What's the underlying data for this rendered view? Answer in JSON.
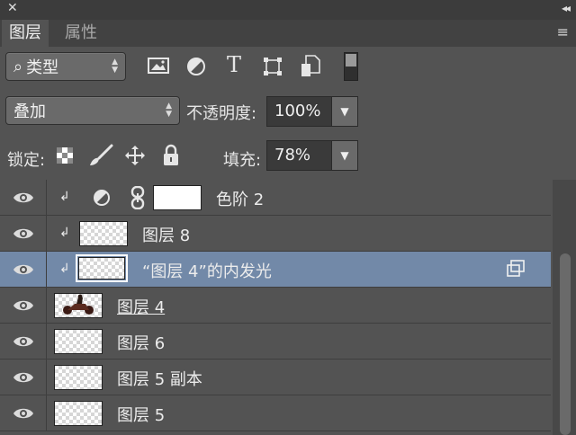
{
  "titlebar": {
    "close_glyph": "✕",
    "collapse_glyph": "◂◂"
  },
  "tabs": [
    {
      "label": "图层",
      "active": true
    },
    {
      "label": "属性",
      "active": false
    }
  ],
  "panel_menu_icon": "≡",
  "filter": {
    "search_glyph": "⌕",
    "kind_label": "类型",
    "type_icons": [
      "image-filter-icon",
      "adjustment-filter-icon",
      "type-filter-icon",
      "shape-filter-icon",
      "smart-object-filter-icon",
      "filter-toggle-icon"
    ],
    "type_glyph": "T"
  },
  "blend": {
    "mode": "叠加",
    "opacity_label": "不透明度:",
    "opacity_value": "100%"
  },
  "lock": {
    "label": "锁定:",
    "fill_label": "填充:",
    "fill_value": "78%"
  },
  "layers": [
    {
      "name": "色阶 2",
      "clipped": true,
      "kind": "adjustment",
      "selected": false
    },
    {
      "name": "图层 8",
      "clipped": true,
      "kind": "pixel",
      "selected": false
    },
    {
      "name": "“图层 4”的内发光",
      "clipped": true,
      "kind": "pixel-masked",
      "selected": true
    },
    {
      "name": "图层 4",
      "clipped": false,
      "kind": "pixel-motorbike",
      "selected": false,
      "underlined": true
    },
    {
      "name": "图层 6",
      "clipped": false,
      "kind": "pixel",
      "selected": false
    },
    {
      "name": "图层 5 副本",
      "clipped": false,
      "kind": "pixel",
      "selected": false
    },
    {
      "name": "图层 5",
      "clipped": false,
      "kind": "pixel",
      "selected": false
    }
  ],
  "clip_glyph": "↲",
  "colors": {
    "panel_bg": "#535353",
    "selected_row": "#7289a8",
    "titlebar": "#3c3c3c"
  }
}
